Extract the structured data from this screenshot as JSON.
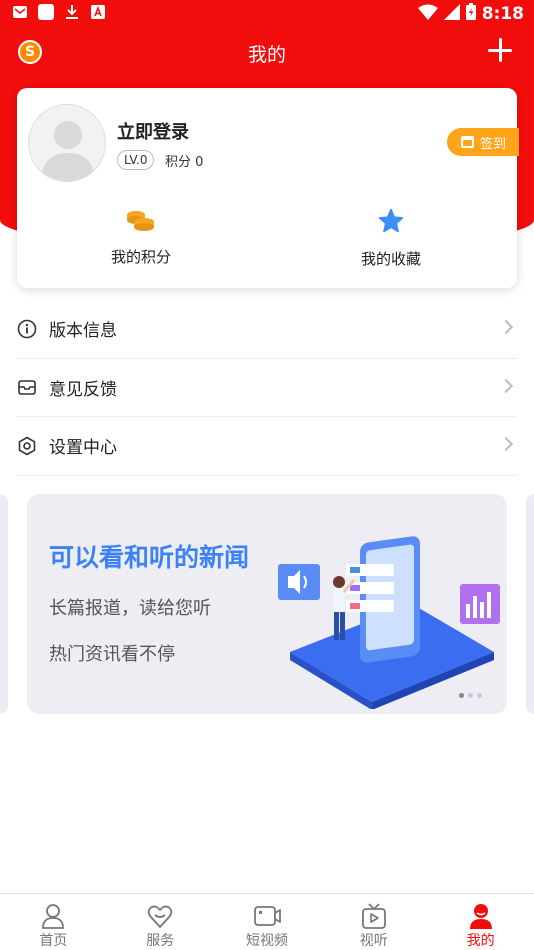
{
  "status_bar": {
    "time": "8:18",
    "left_icons": [
      "mail-icon",
      "square-icon",
      "download-icon",
      "font-icon"
    ],
    "right_icons": [
      "wifi-icon",
      "signal-icon",
      "battery-icon"
    ]
  },
  "header": {
    "title": "我的",
    "logo_icon": "app-logo-icon",
    "add_icon": "plus-icon"
  },
  "profile": {
    "login_label": "立即登录",
    "level": "LV.0",
    "points_label": "积分 0",
    "signin_label": "签到"
  },
  "card_actions": [
    {
      "label": "我的积分",
      "icon": "coins-icon"
    },
    {
      "label": "我的收藏",
      "icon": "star-icon"
    }
  ],
  "menu": [
    {
      "label": "版本信息",
      "icon": "info-icon"
    },
    {
      "label": "意见反馈",
      "icon": "feedback-icon"
    },
    {
      "label": "设置中心",
      "icon": "settings-icon"
    }
  ],
  "banner": {
    "title": "可以看和听的新闻",
    "line1": "长篇报道，读给您听",
    "line2": "热门资讯看不停",
    "page_dots": 3,
    "active_dot": 0
  },
  "bottom_nav": [
    {
      "label": "首页",
      "icon": "home-person-icon",
      "active": false
    },
    {
      "label": "服务",
      "icon": "heart-service-icon",
      "active": false
    },
    {
      "label": "短视频",
      "icon": "video-icon",
      "active": false
    },
    {
      "label": "视听",
      "icon": "tv-icon",
      "active": false
    },
    {
      "label": "我的",
      "icon": "profile-icon",
      "active": true
    }
  ],
  "colors": {
    "brand_red": "#f20d0d",
    "signin_orange": "#ffa41b",
    "banner_blue": "#3b82f6",
    "star_blue": "#3b8ff6",
    "coin_orange": "#f5a623"
  }
}
